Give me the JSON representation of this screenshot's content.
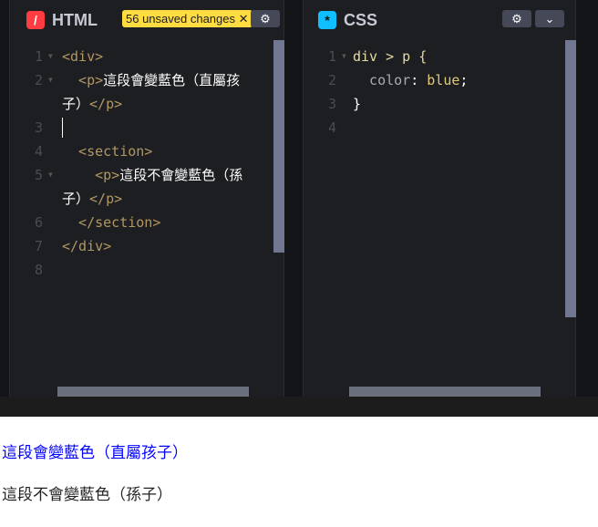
{
  "html_panel": {
    "title": "HTML",
    "logo": "/",
    "badge": "56 unsaved changes",
    "badge_close": "✕",
    "settings_icon": "⚙",
    "lines": [
      {
        "n": "1",
        "parts": [
          {
            "t": "<div>",
            "c": "tag"
          }
        ]
      },
      {
        "n": "2",
        "parts": [
          {
            "t": "  <p>",
            "c": "tag"
          },
          {
            "t": "這段會變藍色（直屬孩",
            "c": ""
          }
        ]
      },
      {
        "n": "",
        "parts": [
          {
            "t": "子）",
            "c": ""
          },
          {
            "t": "</p>",
            "c": "tag"
          }
        ]
      },
      {
        "n": "3",
        "parts": []
      },
      {
        "n": "4",
        "parts": [
          {
            "t": "  <section>",
            "c": "tag"
          }
        ]
      },
      {
        "n": "5",
        "parts": [
          {
            "t": "    <p>",
            "c": "tag"
          },
          {
            "t": "這段不會變藍色（孫",
            "c": ""
          }
        ]
      },
      {
        "n": "",
        "parts": [
          {
            "t": "子）",
            "c": ""
          },
          {
            "t": "</p>",
            "c": "tag"
          }
        ]
      },
      {
        "n": "6",
        "parts": [
          {
            "t": "  </section>",
            "c": "tag"
          }
        ]
      },
      {
        "n": "7",
        "parts": [
          {
            "t": "</div>",
            "c": "tag"
          }
        ]
      },
      {
        "n": "8",
        "parts": []
      }
    ]
  },
  "css_panel": {
    "title": "CSS",
    "logo": "*",
    "settings_icon": "⚙",
    "collapse_icon": "⌄",
    "lines": [
      {
        "n": "1",
        "parts": [
          {
            "t": "div > p {",
            "c": "sel"
          }
        ]
      },
      {
        "n": "2",
        "parts": [
          {
            "t": "  color",
            "c": "prop"
          },
          {
            "t": ": ",
            "c": ""
          },
          {
            "t": "blue",
            "c": "val"
          },
          {
            "t": ";",
            "c": ""
          }
        ]
      },
      {
        "n": "3",
        "parts": [
          {
            "t": "}",
            "c": ""
          }
        ]
      },
      {
        "n": "4",
        "parts": []
      }
    ]
  },
  "preview": {
    "p1": "這段會變藍色（直屬孩子）",
    "p2": "這段不會變藍色（孫子）",
    "p1_color": "#0000ff",
    "p2_color": "#222222"
  }
}
